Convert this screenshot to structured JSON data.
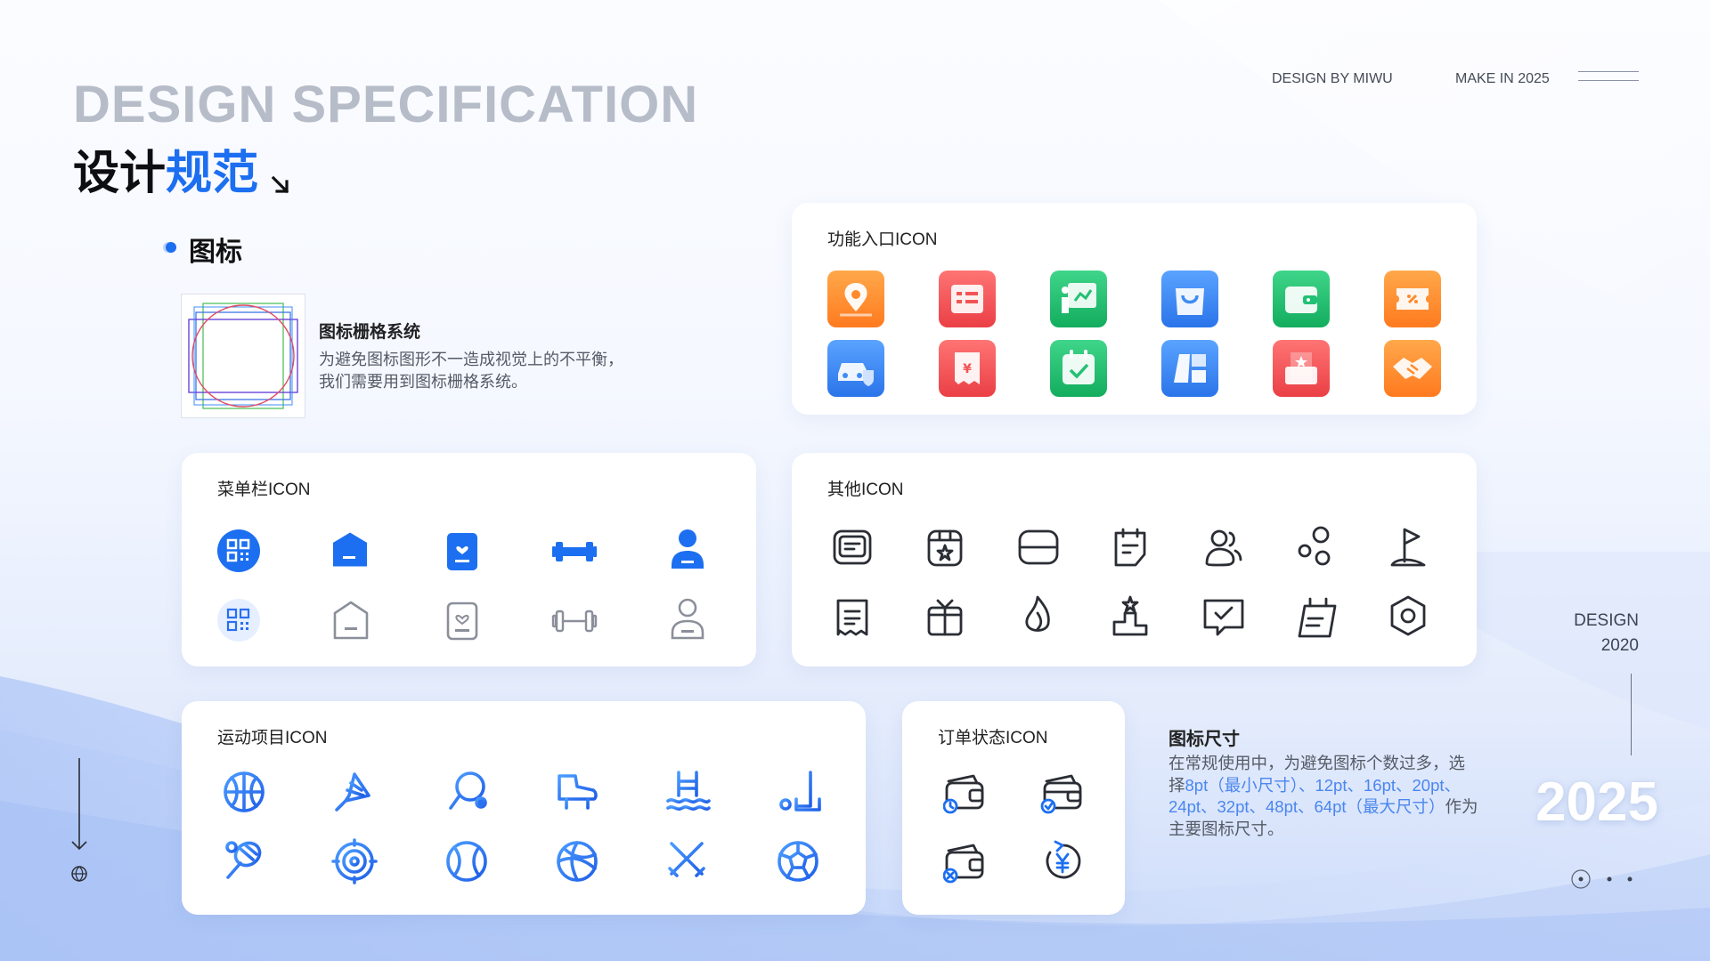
{
  "header": {
    "title_en": "DESIGN SPECIFICATION",
    "title_cn_part1": "设计",
    "title_cn_part2": "规范",
    "design_by": "DESIGN BY MIWU",
    "make_in": "MAKE IN 2025"
  },
  "section": {
    "title": "图标",
    "grid_title": "图标栅格系统",
    "grid_desc_line1": "为避免图标图形不一造成视觉上的不平衡，",
    "grid_desc_line2": "我们需要用到图标栅格系统。"
  },
  "cards": {
    "function_entry": {
      "title": "功能入口ICON"
    },
    "menu_bar": {
      "title": "菜单栏ICON"
    },
    "other": {
      "title": "其他ICON"
    },
    "sports": {
      "title": "运动项目ICON"
    },
    "order_status": {
      "title": "订单状态ICON"
    }
  },
  "size": {
    "title": "图标尺寸",
    "text_part1": "在常规使用中，为避免图标个数过多，选择",
    "text_highlight": "8pt（最小尺寸）、12pt、16pt、20pt、24pt、32pt、48pt、64pt（最大尺寸）",
    "text_part2": "作为主要图标尺寸。"
  },
  "side": {
    "design": "DESIGN",
    "design_year": "2020",
    "big_year": "2025"
  },
  "colors": {
    "accent_blue": "#1c6ff0",
    "orange": "#ff8a2a",
    "red": "#f15454",
    "green": "#22c074",
    "blue": "#3f8cf4"
  },
  "icons": {
    "function_entry": [
      "map-pin-icon",
      "document-list-icon",
      "presentation-icon",
      "shopping-bag-icon",
      "wallet-icon",
      "coupon-icon",
      "car-shield-icon",
      "receipt-icon",
      "calendar-check-icon",
      "folder-map-icon",
      "gift-card-icon",
      "handshake-icon"
    ],
    "menu_bar_active": [
      "qrcode-icon",
      "home-icon",
      "profile-card-icon",
      "dumbbell-icon",
      "user-icon"
    ],
    "menu_bar_inactive": [
      "qrcode-icon",
      "home-icon",
      "profile-card-icon",
      "dumbbell-icon",
      "user-icon"
    ],
    "other": [
      "message-icon",
      "store-icon",
      "card-icon",
      "note-icon",
      "users-icon",
      "bubbles-icon",
      "flag-icon",
      "ticket-icon",
      "gift-box-icon",
      "flame-icon",
      "podium-icon",
      "chat-check-icon",
      "calendar-icon",
      "hexagon-icon"
    ],
    "sports": [
      "basketball-icon",
      "badminton-icon",
      "table-tennis-icon",
      "skate-icon",
      "swimming-icon",
      "golf-icon",
      "tennis-racket-icon",
      "target-icon",
      "baseball-icon",
      "volleyball-icon",
      "fencing-icon",
      "football-icon"
    ],
    "order_status": [
      "wallet-pending-icon",
      "wallet-done-icon",
      "wallet-cancel-icon",
      "refund-icon"
    ]
  }
}
